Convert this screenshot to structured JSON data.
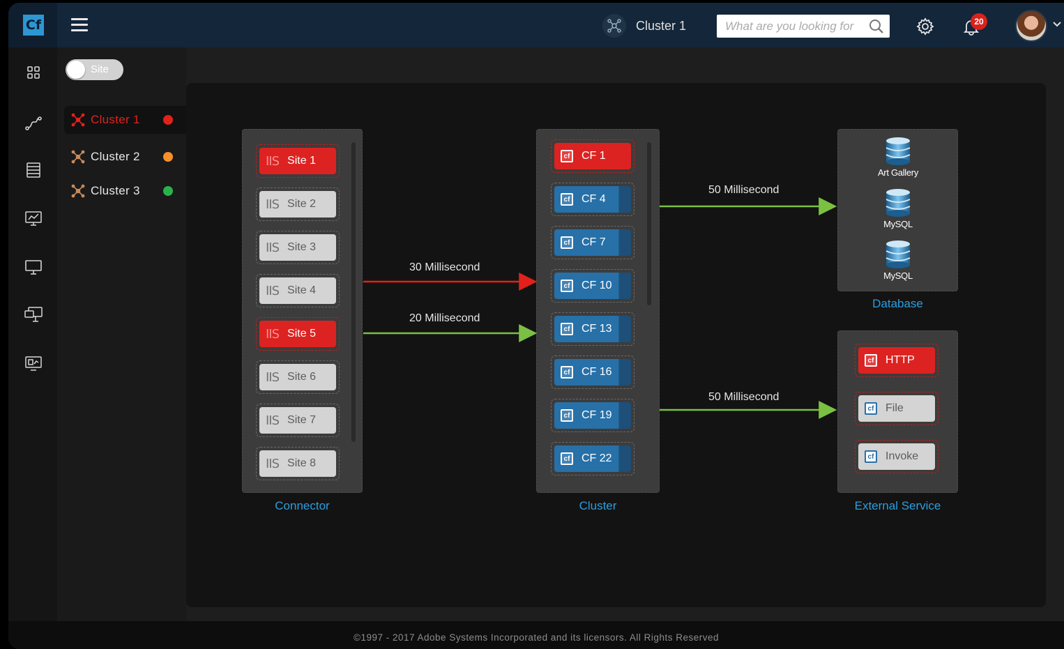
{
  "app": {
    "logo": "Cf"
  },
  "header": {
    "cluster_label": "Cluster 1",
    "search_placeholder": "What are you looking for",
    "notifications": "20"
  },
  "rail": [
    "dashboard-icon",
    "connector-route-icon",
    "server-list-icon",
    "monitor-chart-icon",
    "display-icon",
    "display-network-icon",
    "monitor-analytics-icon"
  ],
  "panel": {
    "toggle_label": "Site",
    "clusters": [
      {
        "name": "Cluster  1",
        "status_color": "#e3211b",
        "active": true
      },
      {
        "name": "Cluster  2",
        "status_color": "#f5902a",
        "active": false
      },
      {
        "name": "Cluster  3",
        "status_color": "#28b34a",
        "active": false
      }
    ]
  },
  "connector": {
    "label": "Connector",
    "icon_text": "IIS",
    "sites": [
      {
        "name": "Site 1",
        "status": "error"
      },
      {
        "name": "Site 2",
        "status": "ok"
      },
      {
        "name": "Site 3",
        "status": "ok"
      },
      {
        "name": "Site 4",
        "status": "ok"
      },
      {
        "name": "Site 5",
        "status": "error"
      },
      {
        "name": "Site 6",
        "status": "ok"
      },
      {
        "name": "Site 7",
        "status": "ok"
      },
      {
        "name": "Site 8",
        "status": "ok"
      }
    ]
  },
  "cluster": {
    "label": "Cluster",
    "icon_text": "cf",
    "instances": [
      {
        "name": "CF 1",
        "status": "error"
      },
      {
        "name": "CF 4",
        "status": "ok"
      },
      {
        "name": "CF 7",
        "status": "ok"
      },
      {
        "name": "CF 10",
        "status": "ok"
      },
      {
        "name": "CF 13",
        "status": "ok"
      },
      {
        "name": "CF 16",
        "status": "ok"
      },
      {
        "name": "CF 19",
        "status": "ok"
      },
      {
        "name": "CF 22",
        "status": "ok"
      }
    ]
  },
  "links": {
    "connector_to_cluster_slow": "30 Millisecond",
    "connector_to_cluster_fast": "20 Millisecond",
    "cluster_to_database": "50 Millisecond",
    "cluster_to_external": "50 Millisecond",
    "colors": {
      "slow": "#e3211b",
      "ok": "#7ac143"
    }
  },
  "database": {
    "label": "Database",
    "items": [
      "Art Gallery",
      "MySQL",
      "MySQL"
    ]
  },
  "external": {
    "label": "External Service",
    "items": [
      {
        "name": "HTTP",
        "status": "error"
      },
      {
        "name": "File",
        "status": "ok"
      },
      {
        "name": "Invoke",
        "status": "ok"
      }
    ]
  },
  "footer": {
    "text": "©1997 - 2017 Adobe Systems Incorporated and its licensors. All Rights Reserved"
  }
}
